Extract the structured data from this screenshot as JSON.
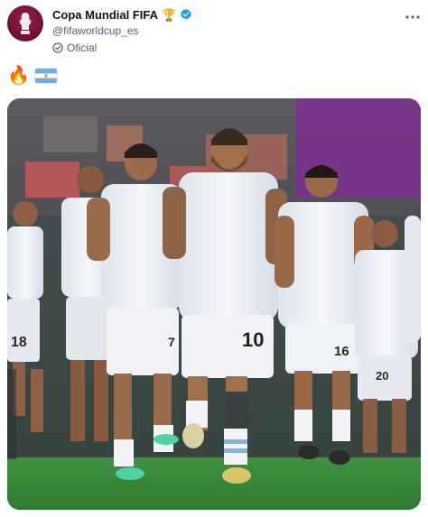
{
  "account": {
    "display_name": "Copa Mundial FIFA",
    "name_emoji": "🏆",
    "handle": "@fifaworldcup_es",
    "label": "Oficial",
    "avatar_icon": "fifa-world-cup-logo",
    "verified_icon": "verified-badge-icon"
  },
  "tweet": {
    "emoji": "🔥",
    "flag_icon": "argentina-flag-icon"
  },
  "media": {
    "shirt_numbers": [
      "18",
      "7",
      "10",
      "16",
      "20"
    ]
  },
  "colors": {
    "verified": "#1d9bf0",
    "avatar": "#6d0f36",
    "pitch": "#3b8a3e",
    "kit": "#eef1f6",
    "sleeve_stripe": "#7cb4e2"
  }
}
